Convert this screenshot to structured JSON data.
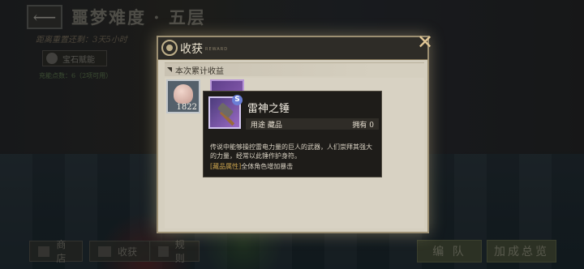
{
  "header": {
    "back_icon": "arrow-left-icon",
    "title": "噩梦难度 · 五层",
    "reset_text": "距离重置还剩：3天5小时",
    "gem_label": "宝石赋能",
    "points_text": "充能点数：6（2项可用）"
  },
  "bottom_bar": {
    "shop": "商店",
    "gains": "收获",
    "rules": "规则",
    "team": "编 队",
    "bonus": "加成总览"
  },
  "panel": {
    "title": "收获",
    "subtitle": "REWARD",
    "section": "本次累计收益",
    "close_icon": "close-icon",
    "items": [
      {
        "icon": "shell-icon",
        "quantity": "1822",
        "rarity_color": "#c2c7cc"
      },
      {
        "icon": "hammer-icon",
        "badge": "S",
        "rarity_color": "#b896d8"
      }
    ]
  },
  "tooltip": {
    "name": "雷神之锤",
    "badge": "S",
    "usage_label": "用途",
    "usage_value": "藏品",
    "owned_label": "拥有",
    "owned_value": "0",
    "description": "传说中能够操控雷电力量的巨人的武器，人们崇拜其强大的力量，经常以此锤作护身符。",
    "attr_tag": "[藏品属性]",
    "attr_text": "全体角色增加暴击"
  }
}
